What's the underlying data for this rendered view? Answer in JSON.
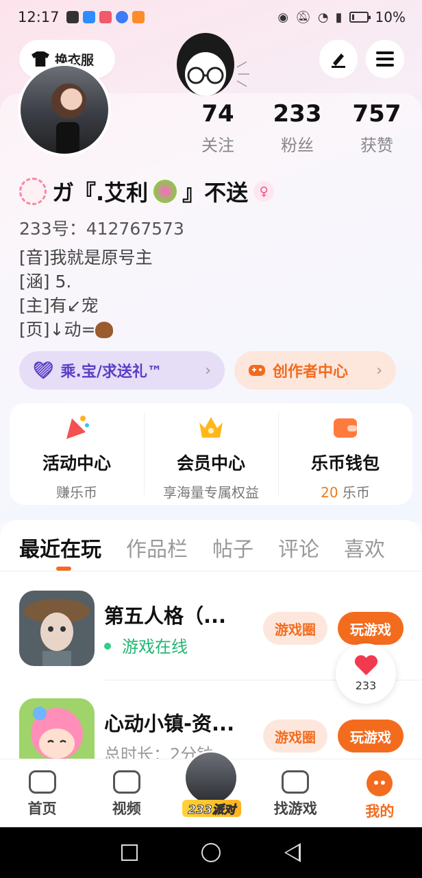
{
  "status_bar": {
    "time": "12:17",
    "battery": "10%"
  },
  "header": {
    "change_outfit": "换衣服"
  },
  "profile": {
    "name": "ガ『.艾利",
    "name_suffix": "』不送",
    "id_line": "233号：412767573",
    "bio": [
      "[音]我就是原号主",
      "[涵] 5.",
      "[主]有↙宠",
      "[页]↓动="
    ],
    "stats": [
      {
        "value": "74",
        "label": "关注"
      },
      {
        "value": "233",
        "label": "粉丝"
      },
      {
        "value": "757",
        "label": "获赞"
      }
    ]
  },
  "pills": {
    "family": "乘.宝/求送礼™",
    "creator": "创作者中心"
  },
  "services": [
    {
      "title": "活动中心",
      "sub": "赚乐币"
    },
    {
      "title": "会员中心",
      "sub": "享海量专属权益"
    },
    {
      "title": "乐币钱包",
      "sub_value": "20",
      "sub_unit": " 乐币"
    }
  ],
  "tabs": [
    "最近在玩",
    "作品栏",
    "帖子",
    "评论",
    "喜欢"
  ],
  "games": [
    {
      "title": "第五人格（...",
      "sub": "游戏在线",
      "circle": "游戏圈",
      "play": "玩游戏"
    },
    {
      "title": "心动小镇-资...",
      "sub": "总时长：2分钟",
      "circle": "游戏圈",
      "play": "玩游戏"
    }
  ],
  "like_fab": {
    "count": "233"
  },
  "bottom_nav": [
    {
      "label": "首页"
    },
    {
      "label": "视频"
    },
    {
      "label": "233派对"
    },
    {
      "label": "找游戏"
    },
    {
      "label": "我的"
    }
  ],
  "colors": {
    "accent": "#f36c1e",
    "purple": "#5b3ec4",
    "online": "#22b573"
  }
}
